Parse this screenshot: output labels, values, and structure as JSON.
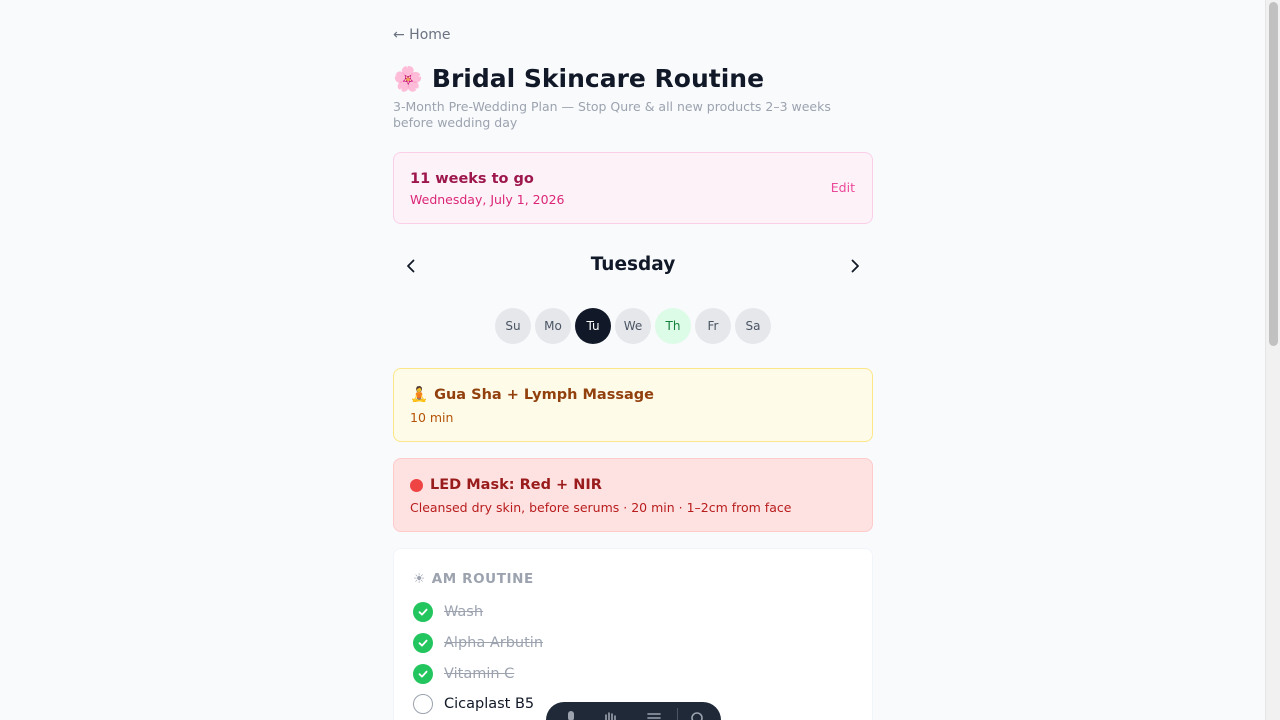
{
  "nav": {
    "back_label": "← Home"
  },
  "header": {
    "emoji": "🌸",
    "title": "Bridal Skincare Routine",
    "subtitle": "3-Month Pre-Wedding Plan — Stop Qure & all new products 2–3 weeks before wedding day"
  },
  "countdown": {
    "weeks_label": "11 weeks to go",
    "date": "Wednesday, July 1, 2026",
    "edit_label": "Edit"
  },
  "day_nav": {
    "current_day": "Tuesday",
    "prev_icon": "chevron-left-icon",
    "next_icon": "chevron-right-icon"
  },
  "week_days": [
    {
      "label": "Su",
      "state": "default"
    },
    {
      "label": "Mo",
      "state": "default"
    },
    {
      "label": "Tu",
      "state": "active"
    },
    {
      "label": "We",
      "state": "default"
    },
    {
      "label": "Th",
      "state": "special"
    },
    {
      "label": "Fr",
      "state": "default"
    },
    {
      "label": "Sa",
      "state": "default"
    }
  ],
  "gua_sha": {
    "emoji": "🧘",
    "title": "Gua Sha + Lymph Massage",
    "duration": "10 min"
  },
  "led_mask": {
    "title": "LED Mask: Red + NIR",
    "detail": "Cleansed dry skin, before serums · 20 min · 1–2cm from face"
  },
  "am_routine": {
    "icon": "☀",
    "heading": "AM ROUTINE",
    "steps": [
      {
        "label": "Wash",
        "done": true
      },
      {
        "label": "Alpha Arbutin",
        "done": true
      },
      {
        "label": "Vitamin C",
        "done": true
      },
      {
        "label": "Cicaplast B5",
        "done": false
      }
    ]
  },
  "colors": {
    "accent_pink": "#db2777",
    "done_green": "#22c55e",
    "active_pill": "#111827",
    "led_red": "#ef4444"
  }
}
